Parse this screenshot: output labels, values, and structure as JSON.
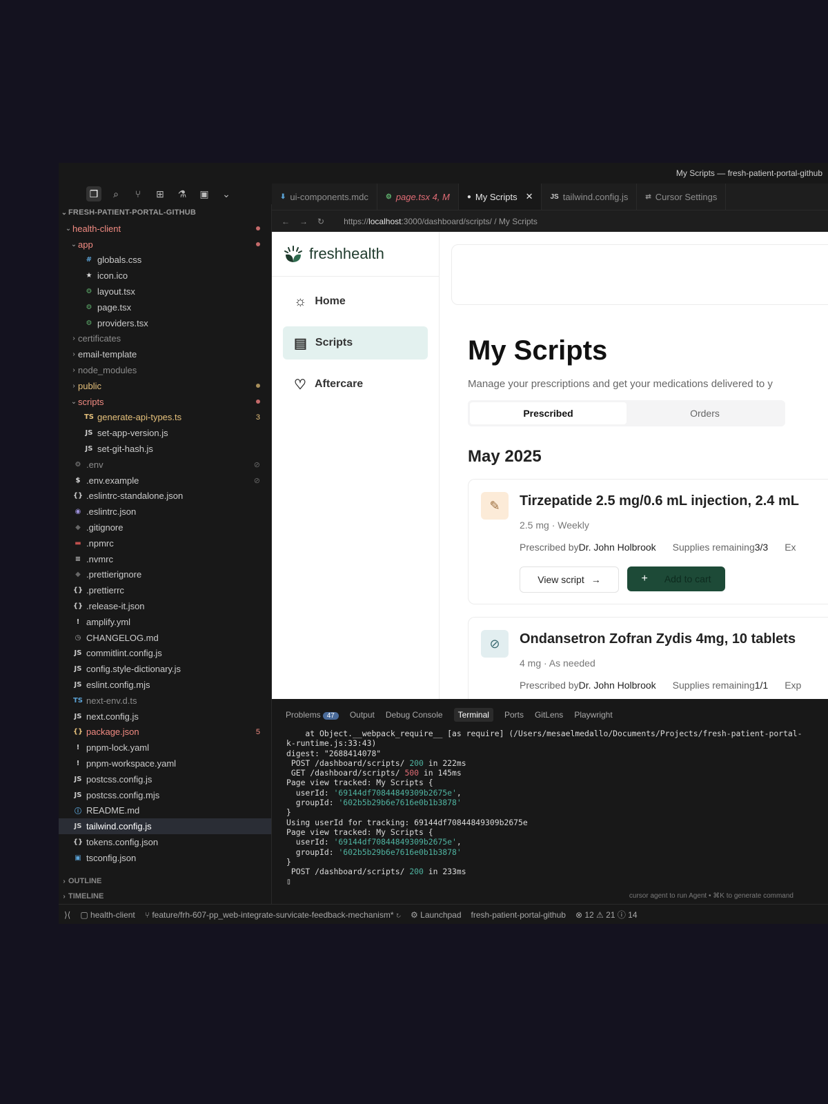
{
  "window": {
    "title": "My Scripts — fresh-patient-portal-github"
  },
  "activity_bar": {
    "icons": [
      "files-icon",
      "search-icon",
      "source-control-icon",
      "extensions-icon",
      "testing-icon",
      "remote-icon",
      "chevron-down-icon"
    ]
  },
  "explorer": {
    "root": "FRESH-PATIENT-PORTAL-GITHUB",
    "rows": [
      {
        "label": "health-client",
        "depth": 1,
        "chev": "⌄",
        "icon": "",
        "color": "#f28b82",
        "dot": "#c46a6a"
      },
      {
        "label": "app",
        "depth": 2,
        "chev": "⌄",
        "icon": "",
        "color": "#f28b82",
        "dot": "#c46a6a"
      },
      {
        "label": "globals.css",
        "depth": 3,
        "chev": "",
        "icon": "#",
        "icolor": "#5aa1d4",
        "color": "#cccccc"
      },
      {
        "label": "icon.ico",
        "depth": 3,
        "chev": "",
        "icon": "★",
        "icolor": "#dddddd",
        "color": "#cccccc"
      },
      {
        "label": "layout.tsx",
        "depth": 3,
        "chev": "",
        "icon": "⚙",
        "icolor": "#5fb06d",
        "color": "#cccccc"
      },
      {
        "label": "page.tsx",
        "depth": 3,
        "chev": "",
        "icon": "⚙",
        "icolor": "#5fb06d",
        "color": "#cccccc"
      },
      {
        "label": "providers.tsx",
        "depth": 3,
        "chev": "",
        "icon": "⚙",
        "icolor": "#5fb06d",
        "color": "#cccccc"
      },
      {
        "label": "certificates",
        "depth": 2,
        "chev": "›",
        "icon": "",
        "color": "#8c8c8c"
      },
      {
        "label": "email-template",
        "depth": 2,
        "chev": "›",
        "icon": "",
        "color": "#cccccc"
      },
      {
        "label": "node_modules",
        "depth": 2,
        "chev": "›",
        "icon": "",
        "color": "#8c8c8c"
      },
      {
        "label": "public",
        "depth": 2,
        "chev": "›",
        "icon": "",
        "color": "#e5c07b",
        "dot": "#a88f5a"
      },
      {
        "label": "scripts",
        "depth": 2,
        "chev": "⌄",
        "icon": "",
        "color": "#f28b82",
        "dot": "#c46a6a"
      },
      {
        "label": "generate-api-types.ts",
        "depth": 3,
        "chev": "",
        "icon": "TS",
        "icolor": "#e5c07b",
        "color": "#e5c07b",
        "badge": "3",
        "bcolor": "#e5c07b"
      },
      {
        "label": "set-app-version.js",
        "depth": 3,
        "chev": "",
        "icon": "JS",
        "icolor": "#cccccc",
        "color": "#cccccc"
      },
      {
        "label": "set-git-hash.js",
        "depth": 3,
        "chev": "",
        "icon": "JS",
        "icolor": "#cccccc",
        "color": "#cccccc"
      },
      {
        "label": ".env",
        "depth": 1,
        "chev": "",
        "icon": "⚙",
        "icolor": "#888888",
        "color": "#8c8c8c",
        "badge": "⊘",
        "bcolor": "#666"
      },
      {
        "label": ".env.example",
        "depth": 1,
        "chev": "",
        "icon": "$",
        "icolor": "#dddddd",
        "color": "#cccccc",
        "badge": "⊘",
        "bcolor": "#666"
      },
      {
        "label": ".eslintrc-standalone.json",
        "depth": 1,
        "chev": "",
        "icon": "{}",
        "icolor": "#cccccc",
        "color": "#cccccc"
      },
      {
        "label": ".eslintrc.json",
        "depth": 1,
        "chev": "",
        "icon": "◉",
        "icolor": "#9b8fd8",
        "color": "#cccccc"
      },
      {
        "label": ".gitignore",
        "depth": 1,
        "chev": "",
        "icon": "◆",
        "icolor": "#666666",
        "color": "#cccccc"
      },
      {
        "label": ".npmrc",
        "depth": 1,
        "chev": "",
        "icon": "▬",
        "icolor": "#c0504d",
        "color": "#cccccc"
      },
      {
        "label": ".nvmrc",
        "depth": 1,
        "chev": "",
        "icon": "≡",
        "icolor": "#cccccc",
        "color": "#cccccc"
      },
      {
        "label": ".prettierignore",
        "depth": 1,
        "chev": "",
        "icon": "◆",
        "icolor": "#666666",
        "color": "#cccccc"
      },
      {
        "label": ".prettierrc",
        "depth": 1,
        "chev": "",
        "icon": "{}",
        "icolor": "#cccccc",
        "color": "#cccccc"
      },
      {
        "label": ".release-it.json",
        "depth": 1,
        "chev": "",
        "icon": "{}",
        "icolor": "#cccccc",
        "color": "#cccccc"
      },
      {
        "label": "amplify.yml",
        "depth": 1,
        "chev": "",
        "icon": "!",
        "icolor": "#cccccc",
        "color": "#cccccc"
      },
      {
        "label": "CHANGELOG.md",
        "depth": 1,
        "chev": "",
        "icon": "◷",
        "icolor": "#aaaaaa",
        "color": "#cccccc"
      },
      {
        "label": "commitlint.config.js",
        "depth": 1,
        "chev": "",
        "icon": "JS",
        "icolor": "#cccccc",
        "color": "#cccccc"
      },
      {
        "label": "config.style-dictionary.js",
        "depth": 1,
        "chev": "",
        "icon": "JS",
        "icolor": "#cccccc",
        "color": "#cccccc"
      },
      {
        "label": "eslint.config.mjs",
        "depth": 1,
        "chev": "",
        "icon": "JS",
        "icolor": "#cccccc",
        "color": "#cccccc"
      },
      {
        "label": "next-env.d.ts",
        "depth": 1,
        "chev": "",
        "icon": "TS",
        "icolor": "#5aa1d4",
        "color": "#8c8c8c"
      },
      {
        "label": "next.config.js",
        "depth": 1,
        "chev": "",
        "icon": "JS",
        "icolor": "#cccccc",
        "color": "#cccccc"
      },
      {
        "label": "package.json",
        "depth": 1,
        "chev": "",
        "icon": "{}",
        "icolor": "#e5c07b",
        "color": "#f28b82",
        "badge": "5",
        "bcolor": "#f28b82"
      },
      {
        "label": "pnpm-lock.yaml",
        "depth": 1,
        "chev": "",
        "icon": "!",
        "icolor": "#cccccc",
        "color": "#cccccc"
      },
      {
        "label": "pnpm-workspace.yaml",
        "depth": 1,
        "chev": "",
        "icon": "!",
        "icolor": "#cccccc",
        "color": "#cccccc"
      },
      {
        "label": "postcss.config.js",
        "depth": 1,
        "chev": "",
        "icon": "JS",
        "icolor": "#cccccc",
        "color": "#cccccc"
      },
      {
        "label": "postcss.config.mjs",
        "depth": 1,
        "chev": "",
        "icon": "JS",
        "icolor": "#cccccc",
        "color": "#cccccc"
      },
      {
        "label": "README.md",
        "depth": 1,
        "chev": "",
        "icon": "ⓘ",
        "icolor": "#5aa1d4",
        "color": "#cccccc"
      },
      {
        "label": "tailwind.config.js",
        "depth": 1,
        "chev": "",
        "icon": "JS",
        "icolor": "#cccccc",
        "color": "#ffffff",
        "selected": true
      },
      {
        "label": "tokens.config.json",
        "depth": 1,
        "chev": "",
        "icon": "{}",
        "icolor": "#cccccc",
        "color": "#cccccc"
      },
      {
        "label": "tsconfig.json",
        "depth": 1,
        "chev": "",
        "icon": "▣",
        "icolor": "#5aa1d4",
        "color": "#cccccc"
      }
    ],
    "outline": "OUTLINE",
    "timeline": "TIMELINE"
  },
  "tabs": [
    {
      "label": "ui-components.mdc",
      "icon": "⬇",
      "icolor": "#5aa1d4",
      "color": "#8f8f8f"
    },
    {
      "label": "page.tsx 4, M",
      "icon": "⚙",
      "icolor": "#5fb06d",
      "color": "#e06c75",
      "italic": true
    },
    {
      "label": "My Scripts",
      "icon": "●",
      "icolor": "#dddddd",
      "color": "#e6e6e6",
      "active": true,
      "close": "✕"
    },
    {
      "label": "tailwind.config.js",
      "icon": "JS",
      "icolor": "#cccccc",
      "color": "#8f8f8f"
    },
    {
      "label": "Cursor Settings",
      "icon": "⇄",
      "icolor": "#8f8f8f",
      "color": "#8f8f8f"
    }
  ],
  "browser": {
    "url_prefix": "https://",
    "url_host": "localhost",
    "url_rest": ":3000/dashboard/scripts/ / My Scripts"
  },
  "app": {
    "logo_bold": "fresh",
    "logo_light": "health",
    "nav": [
      {
        "label": "Home",
        "icon": "☼",
        "name": "nav-home"
      },
      {
        "label": "Scripts",
        "icon": "▤",
        "name": "nav-scripts",
        "active": true
      },
      {
        "label": "Aftercare",
        "icon": "♡",
        "name": "nav-aftercare"
      }
    ],
    "page_title": "My Scripts",
    "subtitle": "Manage your prescriptions and get your medications delivered to y",
    "segments": [
      "Prescribed",
      "Orders"
    ],
    "month": "May 2025",
    "scripts": [
      {
        "name": "Tirzepatide 2.5 mg/0.6 mL injection, 2.4 mL",
        "dose": "2.5 mg · Weekly",
        "prescribed_label": "Prescribed by",
        "doctor": "Dr. John Holbrook",
        "supplies_label": "Supplies remaining",
        "supplies": "3/3",
        "extra": "Ex",
        "icon": "✎",
        "icon_bg": "#fcebd8",
        "icon_color": "#9a6b3a",
        "view": "View script",
        "add": "Add to cart"
      },
      {
        "name": "Ondansetron Zofran Zydis 4mg, 10 tablets",
        "dose": "4 mg · As needed",
        "prescribed_label": "Prescribed by",
        "doctor": "Dr. John Holbrook",
        "supplies_label": "Supplies remaining",
        "supplies": "1/1",
        "extra": "Exp",
        "icon": "⊘",
        "icon_bg": "#e2eef0",
        "icon_color": "#3b6b72"
      }
    ]
  },
  "panel": {
    "tabs": [
      "Problems",
      "Output",
      "Debug Console",
      "Terminal",
      "Ports",
      "GitLens",
      "Playwright"
    ],
    "problems_count": "47",
    "active": "Terminal",
    "terminal_lines": [
      "    at Object.__webpack_require__ [as require] (/Users/mesaelmedallo/Documents/Projects/fresh-patient-portal-",
      "k-runtime.js:33:43)",
      "digest: \"2688414078\"",
      " POST /dashboard/scripts/ 200 in 222ms",
      " GET /dashboard/scripts/ 500 in 145ms",
      "Page view tracked: My Scripts {",
      "  userId: '69144df70844849309b2675e',",
      "  groupId: '602b5b29b6e7616e0b1b3878'",
      "}",
      "Using userId for tracking: 69144df70844849309b2675e",
      "Page view tracked: My Scripts {",
      "  userId: '69144df70844849309b2675e',",
      "  groupId: '602b5b29b6e7616e0b1b3878'",
      "}",
      " POST /dashboard/scripts/ 200 in 233ms",
      "▯"
    ],
    "hint": "cursor agent to run Agent • ⌘K to generate command"
  },
  "statusbar": {
    "folder": "health-client",
    "branch": "feature/frh-607-pp_web-integrate-survicate-feedback-mechanism*",
    "launchpad": "Launchpad",
    "repo": "fresh-patient-portal-github",
    "errors": "12",
    "warnings": "21",
    "info": "14"
  },
  "colors": {
    "accent_green": "#1d4a37",
    "selected_nav": "#e3f1ef",
    "bg": "#14121f"
  }
}
